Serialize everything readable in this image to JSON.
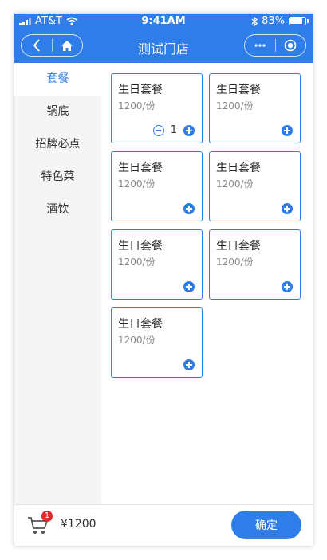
{
  "status_bar": {
    "carrier": "AT&T",
    "time": "9:41AM",
    "battery": "83%"
  },
  "nav": {
    "title": "测试门店"
  },
  "sidebar": {
    "items": [
      {
        "label": "套餐",
        "active": true
      },
      {
        "label": "锅底",
        "active": false
      },
      {
        "label": "招牌必点",
        "active": false
      },
      {
        "label": "特色菜",
        "active": false
      },
      {
        "label": "酒饮",
        "active": false
      }
    ]
  },
  "products": [
    {
      "name": "生日套餐",
      "price": "1200/份",
      "qty": "1"
    },
    {
      "name": "生日套餐",
      "price": "1200/份",
      "qty": ""
    },
    {
      "name": "生日套餐",
      "price": "1200/份",
      "qty": ""
    },
    {
      "name": "生日套餐",
      "price": "1200/份",
      "qty": ""
    },
    {
      "name": "生日套餐",
      "price": "1200/份",
      "qty": ""
    },
    {
      "name": "生日套餐",
      "price": "1200/份",
      "qty": ""
    },
    {
      "name": "生日套餐",
      "price": "1200/份",
      "qty": ""
    }
  ],
  "cart": {
    "badge_count": "1",
    "total": "¥1200",
    "confirm_label": "确定"
  },
  "colors": {
    "accent": "#2f7de9",
    "badge": "#e5252a"
  }
}
